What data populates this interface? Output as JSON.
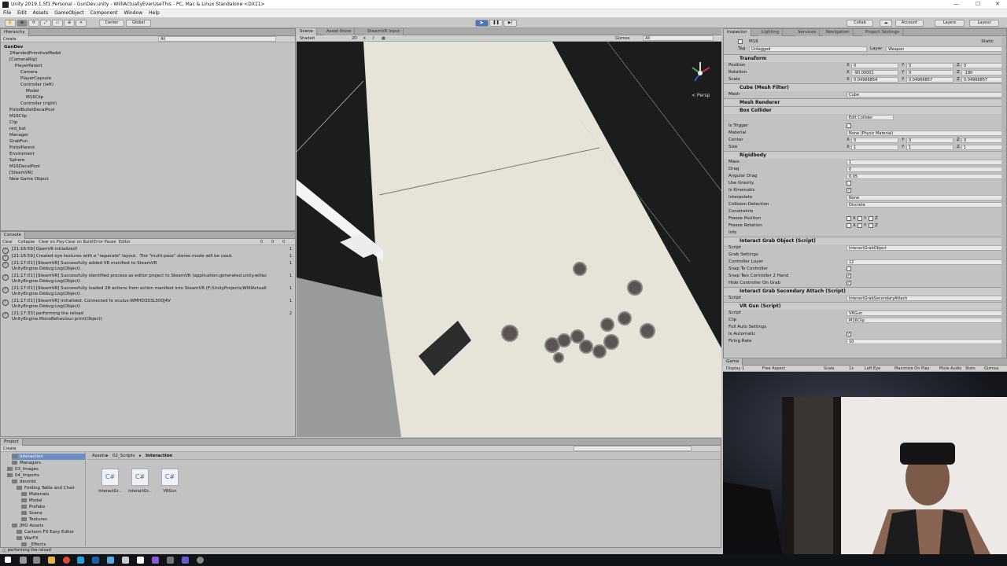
{
  "window": {
    "title": "Unity 2019.1.5f1 Personal - GunDev.unity - WillIActuallyEverUseThis - PC, Mac & Linux Standalone <DX11>"
  },
  "menu": [
    "File",
    "Edit",
    "Assets",
    "GameObject",
    "Component",
    "Window",
    "Help"
  ],
  "toolbar": {
    "center": "Center",
    "global": "Global",
    "collab": "Collab",
    "account": "Account",
    "layers": "Layers",
    "layout": "Layout"
  },
  "hierarchy": {
    "tab": "Hierarchy",
    "create": "Create",
    "search": "All",
    "items": [
      {
        "label": "GunDev",
        "depth": 0,
        "bold": true
      },
      {
        "label": "2HandedPrimitiveModel",
        "depth": 1
      },
      {
        "label": "[CameraRig]",
        "depth": 1
      },
      {
        "label": "PlayerParent",
        "depth": 2
      },
      {
        "label": "Camera",
        "depth": 3
      },
      {
        "label": "PlayerCapsule",
        "depth": 3
      },
      {
        "label": "Controller (left)",
        "depth": 3
      },
      {
        "label": "Model",
        "depth": 4
      },
      {
        "label": "M16Clip",
        "depth": 4
      },
      {
        "label": "Controller (right)",
        "depth": 3
      },
      {
        "label": "PistolBulletDecalPool",
        "depth": 1
      },
      {
        "label": "M16Clip",
        "depth": 1
      },
      {
        "label": "Clip",
        "depth": 1
      },
      {
        "label": "red_bat",
        "depth": 1
      },
      {
        "label": "Manager",
        "depth": 1
      },
      {
        "label": "GrabFun",
        "depth": 1
      },
      {
        "label": "PistolParent",
        "depth": 1
      },
      {
        "label": "Enviroment",
        "depth": 1
      },
      {
        "label": "Sphere",
        "depth": 1
      },
      {
        "label": "M16DecalPool",
        "depth": 1
      },
      {
        "label": "[SteamVR]",
        "depth": 1
      },
      {
        "label": "New Game Object",
        "depth": 1
      }
    ]
  },
  "console": {
    "tab": "Console",
    "buttons": [
      "Clear",
      "Collapse",
      "Clear on Play",
      "Clear on Build",
      "Error Pause",
      "Editor"
    ],
    "counts": [
      "0",
      "0",
      "0"
    ],
    "entries": [
      {
        "text": "[21:16:59] OpenVR initialized!",
        "count": "1"
      },
      {
        "text": "[21:16:59] Created eye textures with a \"separate\" layout.  The \"multi-pass\" stereo mode will be used.",
        "count": "1"
      },
      {
        "text": "[21:17:01] [SteamVR] Successfully added VR manifest to SteamVR\nUnityEngine.Debug:Log(Object)",
        "count": "1"
      },
      {
        "text": "[21:17:01] [SteamVR] Successfully identified process as editor project to SteamVR (application.generated.unity.willac\nUnityEngine.Debug:Log(Object)",
        "count": "1"
      },
      {
        "text": "[21:17:01] [SteamVR] Successfully loaded 28 actions from action manifest into SteamVR (F:/UnityProjects/WillIActuall\nUnityEngine.Debug:Log(Object)",
        "count": "1"
      },
      {
        "text": "[21:17:01] [SteamVR] Initialized. Connected to oculus:WMHD303L500J4V\nUnityEngine.Debug:Log(Object)",
        "count": "1"
      },
      {
        "text": "[21:17:33] performing the reload\nUnityEngine.MonoBehaviour:print(Object)",
        "count": "2"
      }
    ]
  },
  "scene": {
    "tabs": [
      "Scene",
      "Asset Store",
      "SteamVR Input"
    ],
    "shaded": "Shaded",
    "mode_2d": "2D",
    "gizmos": "Gizmos",
    "search": "All",
    "persp": "< Persp"
  },
  "project": {
    "tab": "Project",
    "create": "Create",
    "breadcrumb": [
      "Assets",
      "02_Scripts",
      "Interaction"
    ],
    "tree": [
      {
        "label": "Interaction",
        "depth": 2,
        "selected": true
      },
      {
        "label": "Managers",
        "depth": 2
      },
      {
        "label": "03_Images",
        "depth": 1
      },
      {
        "label": "04_Imports",
        "depth": 1
      },
      {
        "label": "devotid",
        "depth": 2
      },
      {
        "label": "Folding Table and Chair",
        "depth": 3
      },
      {
        "label": "Materials",
        "depth": 4
      },
      {
        "label": "Model",
        "depth": 4
      },
      {
        "label": "Prefabs",
        "depth": 4
      },
      {
        "label": "Scene",
        "depth": 4
      },
      {
        "label": "Textures",
        "depth": 4
      },
      {
        "label": "JMO Assets",
        "depth": 2
      },
      {
        "label": "Cartoon FX Easy Editor",
        "depth": 3
      },
      {
        "label": "WarFX",
        "depth": 3
      },
      {
        "label": "_Effects",
        "depth": 4
      }
    ],
    "files": [
      "InteractGr...",
      "InteractGr...",
      "VRGun"
    ],
    "file_glyph": "C#"
  },
  "inspector": {
    "tabs": [
      "Inspector",
      "Lighting",
      "Services",
      "Navigation",
      "Project Settings"
    ],
    "object_name": "M16",
    "static": "Static",
    "tag_label": "Tag",
    "tag": "Untagged",
    "layer_label": "Layer",
    "layer": "Weapon",
    "transform": {
      "title": "Transform",
      "position": [
        "0",
        "0",
        "0"
      ],
      "rotation": [
        "-90.00001",
        "0",
        "-180"
      ],
      "scale": [
        "0.04966854",
        "0.04966857",
        "0.04966857"
      ]
    },
    "labels": {
      "position": "Position",
      "rotation": "Rotation",
      "scale": "Scale",
      "mesh": "Mesh",
      "is_trigger": "Is Trigger",
      "material": "Material",
      "center": "Center",
      "size": "Size",
      "mass": "Mass",
      "drag": "Drag",
      "angular_drag": "Angular Drag",
      "use_gravity": "Use Gravity",
      "is_kinematic": "Is Kinematic",
      "interpolate": "Interpolate",
      "collision": "Collision Detection",
      "constraints": "Constraints",
      "freeze_pos": "Freeze Position",
      "freeze_rot": "Freeze Rotation",
      "info": "Info",
      "script": "Script",
      "grab_settings": "Grab Settings",
      "controller_layer": "Controller Layer",
      "snap_to_controller": "Snap To Controller",
      "snap_two": "Snap Two Controller 2 Hand",
      "hide_controller": "Hide Controller On Grab",
      "clip": "Clip",
      "full_auto": "Full Auto Settings",
      "is_automatic": "Is Automatic",
      "firing_rate": "Firing Rate",
      "x": "X",
      "y": "Y",
      "z": "Z"
    },
    "mesh_filter": {
      "title": "Cube (Mesh Filter)",
      "mesh": "Cube"
    },
    "mesh_renderer": {
      "title": "Mesh Renderer"
    },
    "box_collider": {
      "title": "Box Collider",
      "edit": "Edit Collider",
      "material": "None (Physic Material)",
      "center": [
        "0",
        "0",
        "0"
      ],
      "size": [
        "1",
        "1",
        "1"
      ]
    },
    "rigidbody": {
      "title": "Rigidbody",
      "mass": "1",
      "drag": "0",
      "angular_drag": "0.05",
      "interpolate": "None",
      "collision": "Discrete"
    },
    "grab": {
      "title": "Interact Grab Object (Script)",
      "script": "InteractGrabObject",
      "controller_layer": "12"
    },
    "grab2": {
      "title": "Interact Grab Secondary Attach (Script)",
      "script": "InteractGrabSecondaryAttach"
    },
    "vrgun": {
      "title": "VR Gun (Script)",
      "script": "VRGun",
      "clip": "M16Clip",
      "firing_rate": "10"
    }
  },
  "game": {
    "tab": "Game",
    "display": "Display 1",
    "aspect": "Free Aspect",
    "scale": "Scale",
    "scale_val": "1x",
    "eye": "Left Eye",
    "maximize": "Maximize On Play",
    "mute": "Mute Audio",
    "stats": "Stats",
    "gizmos": "Gizmos"
  },
  "status": {
    "text": "performing the reload"
  },
  "colors": {
    "accent": "#6b8ec4",
    "scene_bg": "#1c1c1c",
    "floor": "#e6e3d8"
  }
}
